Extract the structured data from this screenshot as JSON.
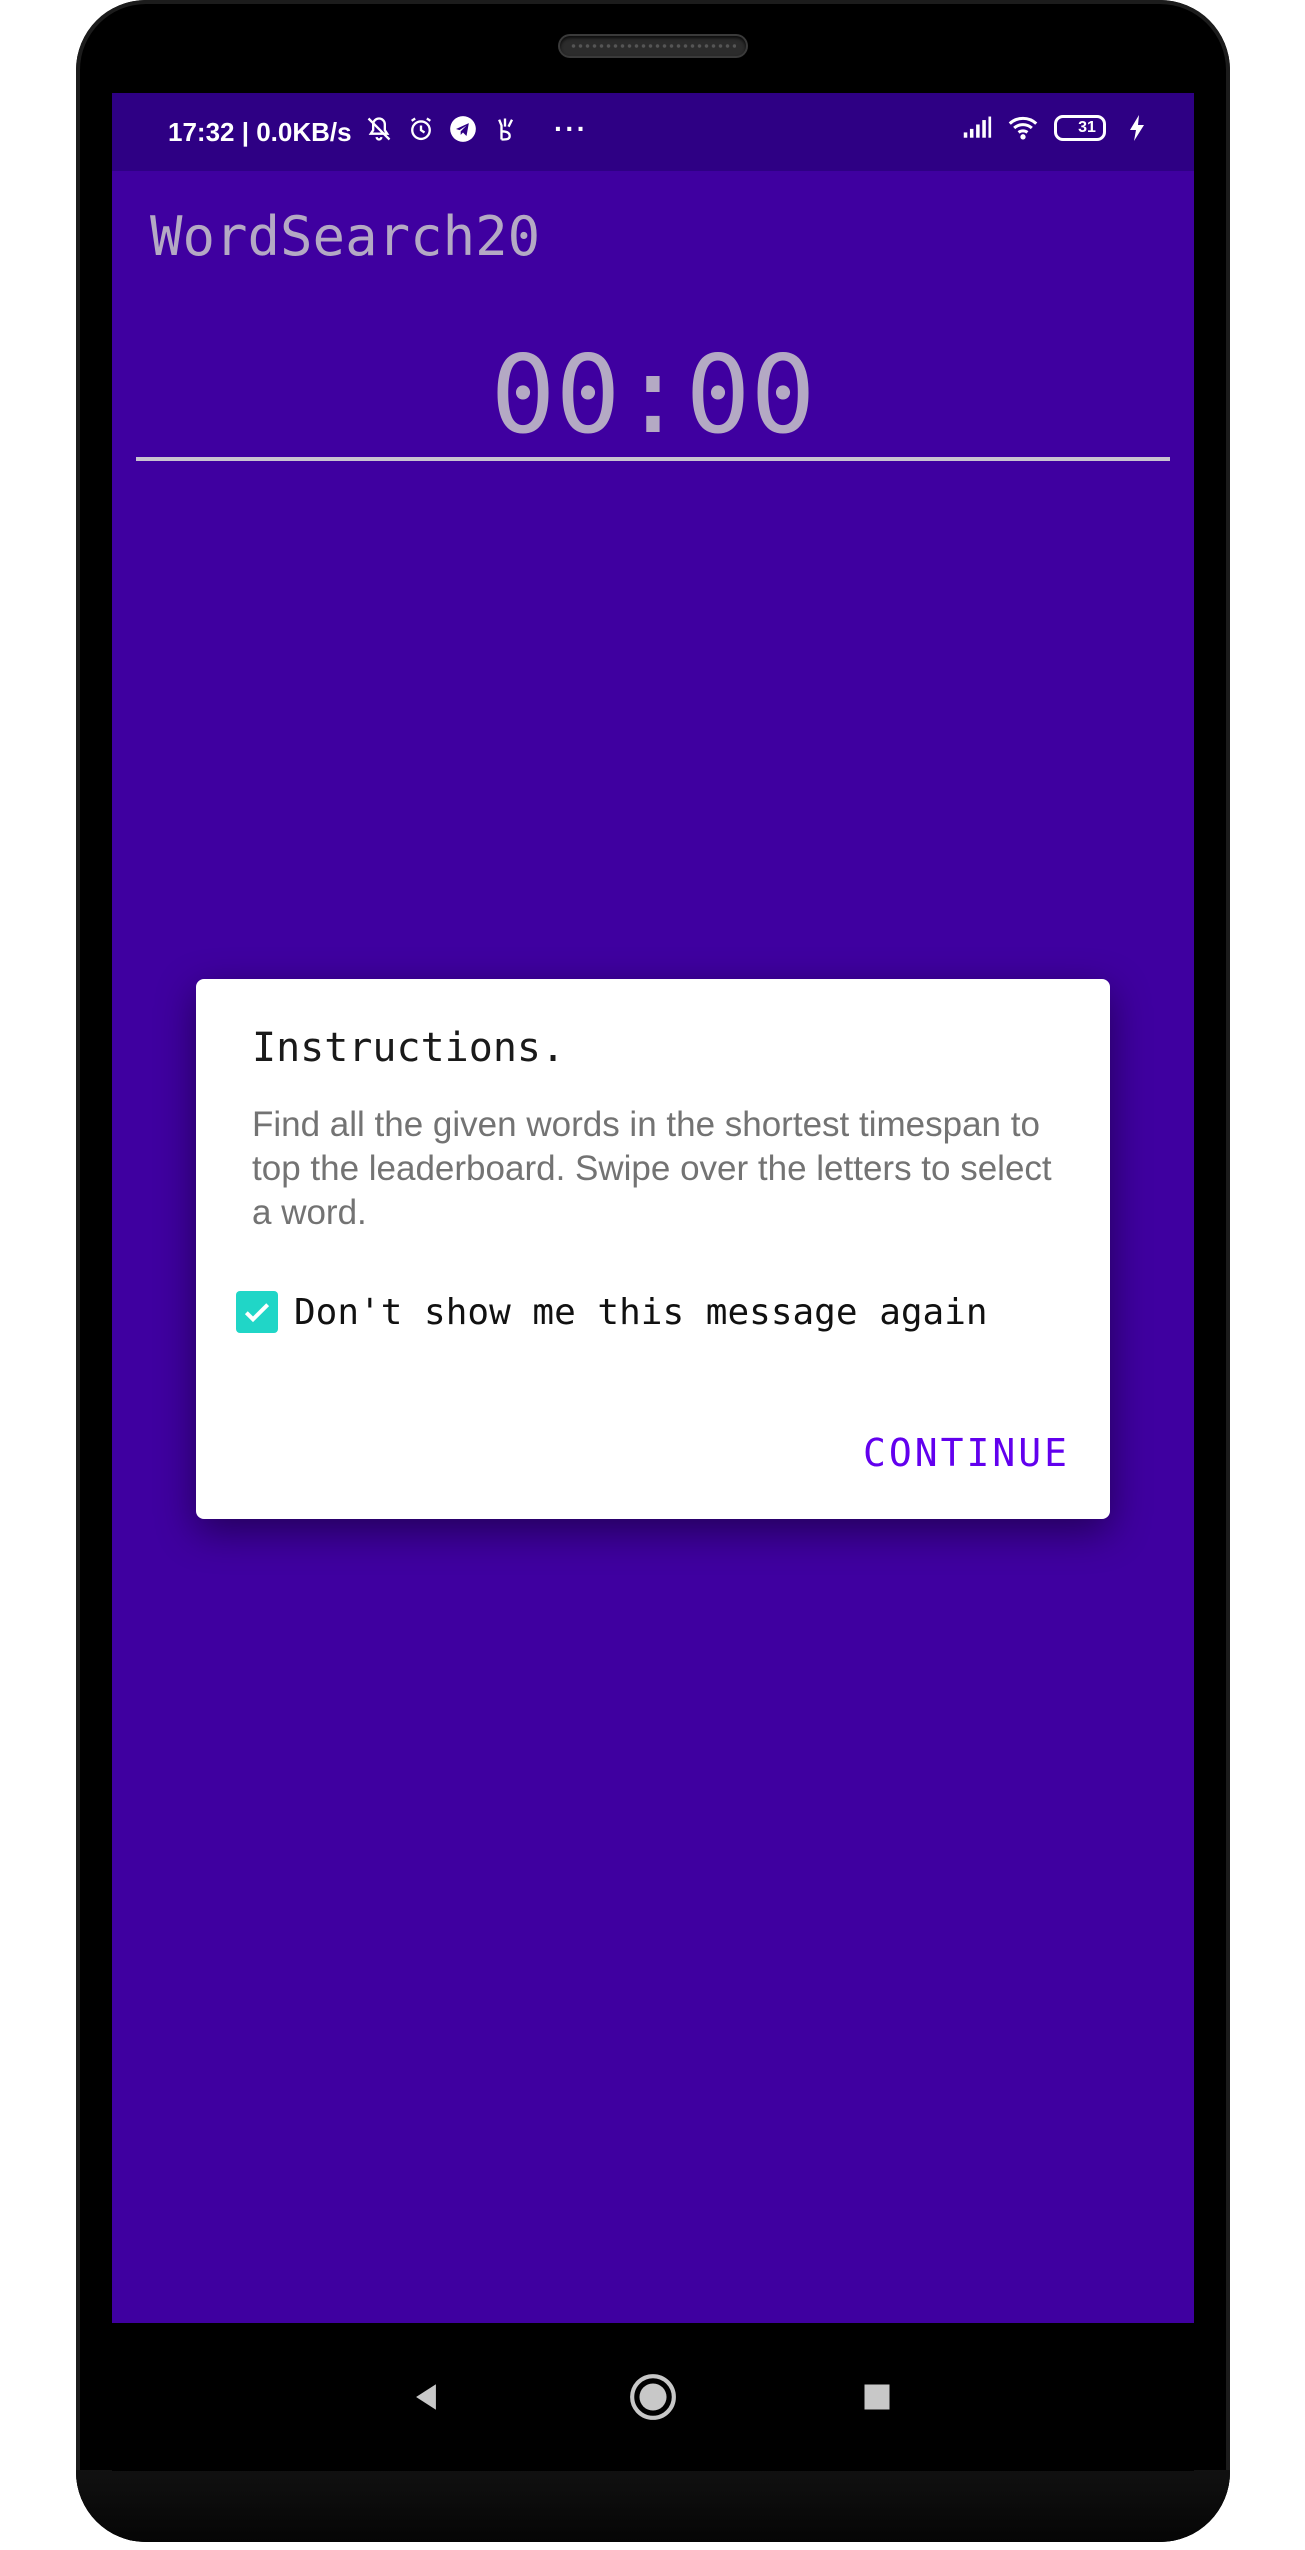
{
  "status_bar": {
    "time_speed": "17:32 | 0.0KB/s",
    "more": "···",
    "battery_level": "31"
  },
  "app": {
    "title": "WordSearch20",
    "timer": "00:00"
  },
  "dialog": {
    "title": "Instructions.",
    "body": "Find all the given words in the shortest timespan to top the leaderboard. Swipe over the letters to select a word.",
    "checkbox_label": "Don't show me this message again",
    "checkbox_checked": true,
    "continue_label": "CONTINUE"
  },
  "colors": {
    "app_background": "#3f00a0",
    "status_bar": "#2e0084",
    "checkbox": "#20d6c7",
    "accent": "#6200ee"
  },
  "icons": {
    "status_left": [
      "mute-bell-icon",
      "alarm-icon",
      "telegram-icon",
      "gesture-icon"
    ],
    "status_right": [
      "signal-icon",
      "wifi-icon",
      "battery-icon",
      "charging-icon"
    ],
    "navigation": [
      "back-icon",
      "home-icon",
      "recents-icon"
    ]
  }
}
